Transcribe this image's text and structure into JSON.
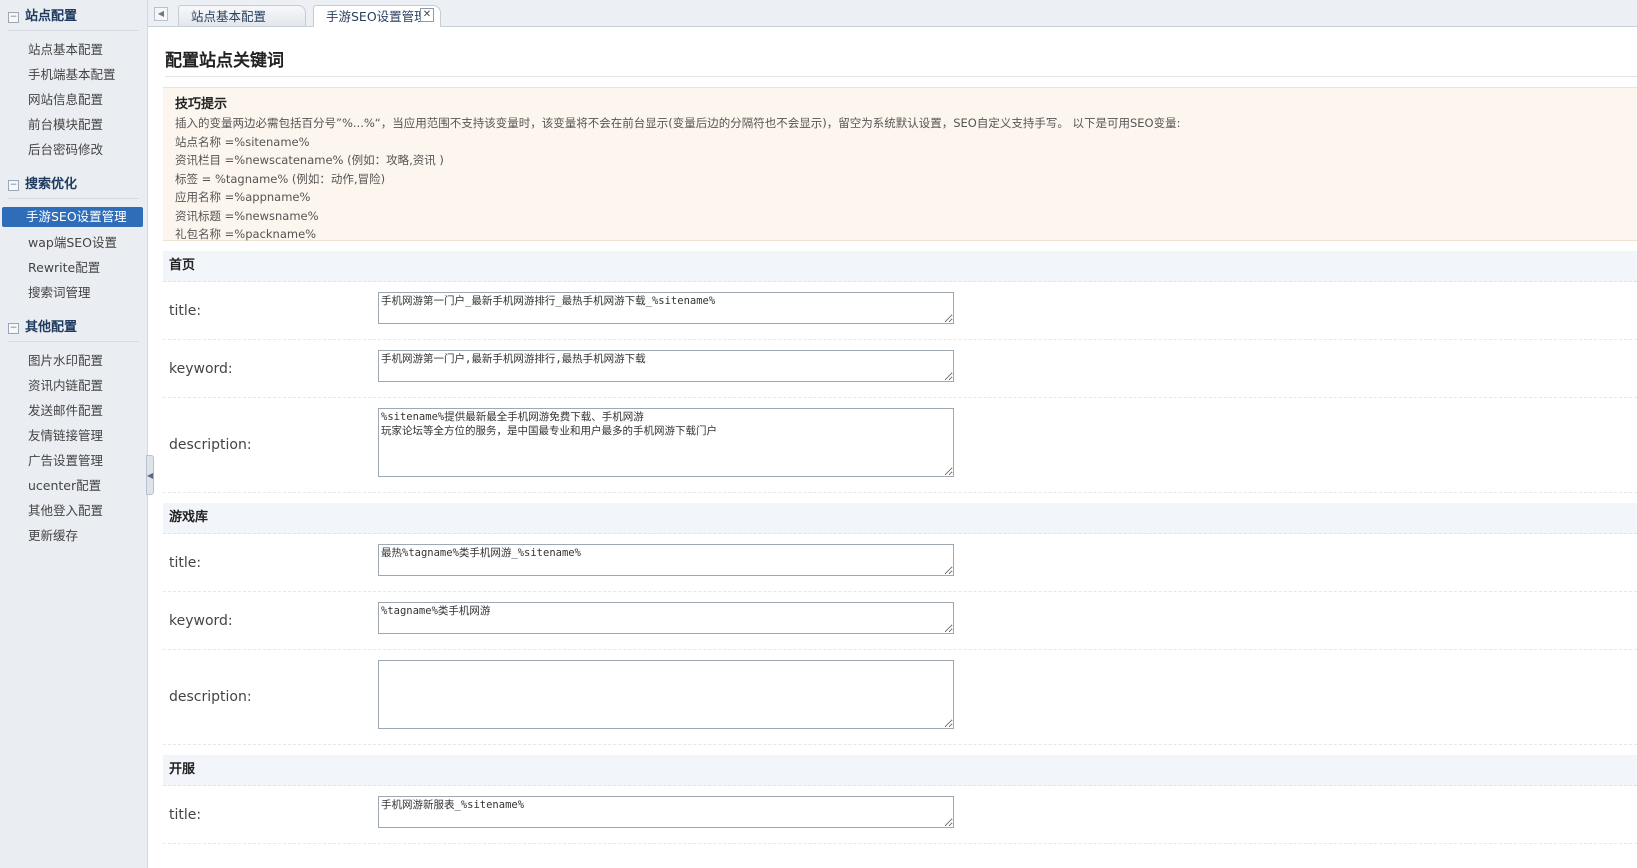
{
  "sidebar": {
    "groups": [
      {
        "title": "站点配置",
        "items": [
          "站点基本配置",
          "手机端基本配置",
          "网站信息配置",
          "前台模块配置",
          "后台密码修改"
        ]
      },
      {
        "title": "搜索优化",
        "items": [
          "手游SEO设置管理",
          "wap端SEO设置",
          "Rewrite配置",
          "搜索词管理"
        ]
      },
      {
        "title": "其他配置",
        "items": [
          "图片水印配置",
          "资讯内链配置",
          "发送邮件配置",
          "友情链接管理",
          "广告设置管理",
          "ucenter配置",
          "其他登入配置",
          "更新缓存"
        ]
      }
    ],
    "toggle_glyph": "−",
    "collapse_glyph": "◀"
  },
  "tabs": {
    "scroll_left_glyph": "◀",
    "items": [
      "站点基本配置",
      "手游SEO设置管理"
    ],
    "close_glyph": "✕"
  },
  "page_title": "配置站点关键词",
  "tips": {
    "title": "技巧提示",
    "lines": [
      "插入的变量两边必需包括百分号”%...%“，当应用范围不支持该变量时，该变量将不会在前台显示(变量后边的分隔符也不会显示)，留空为系统默认设置，SEO自定义支持手写。 以下是可用SEO变量:",
      "站点名称 =%sitename%",
      "资讯栏目 =%newscatename% (例如：攻略,资讯 )",
      "标签 = %tagname% (例如：动作,冒险)",
      "应用名称 =%appname%",
      "资讯标题 =%newsname%",
      "礼包名称 =%packname%"
    ]
  },
  "labels": {
    "title": "title:",
    "keyword": "keyword:",
    "description": "description:"
  },
  "sections": {
    "home": {
      "heading": "首页",
      "title_value": "手机网游第一门户_最新手机网游排行_最热手机网游下载_%sitename%",
      "keyword_value": "手机网游第一门户,最新手机网游排行,最热手机网游下载",
      "description_value": "%sitename%提供最新最全手机网游免费下载、手机网游\n玩家论坛等全方位的服务，是中国最专业和用户最多的手机网游下载门户"
    },
    "games": {
      "heading": "游戏库",
      "title_value": "最热%tagname%类手机网游_%sitename%",
      "keyword_value": "%tagname%类手机网游",
      "description_value": ""
    },
    "servers": {
      "heading": "开服",
      "title_value": "手机网游新服表_%sitename%"
    }
  }
}
